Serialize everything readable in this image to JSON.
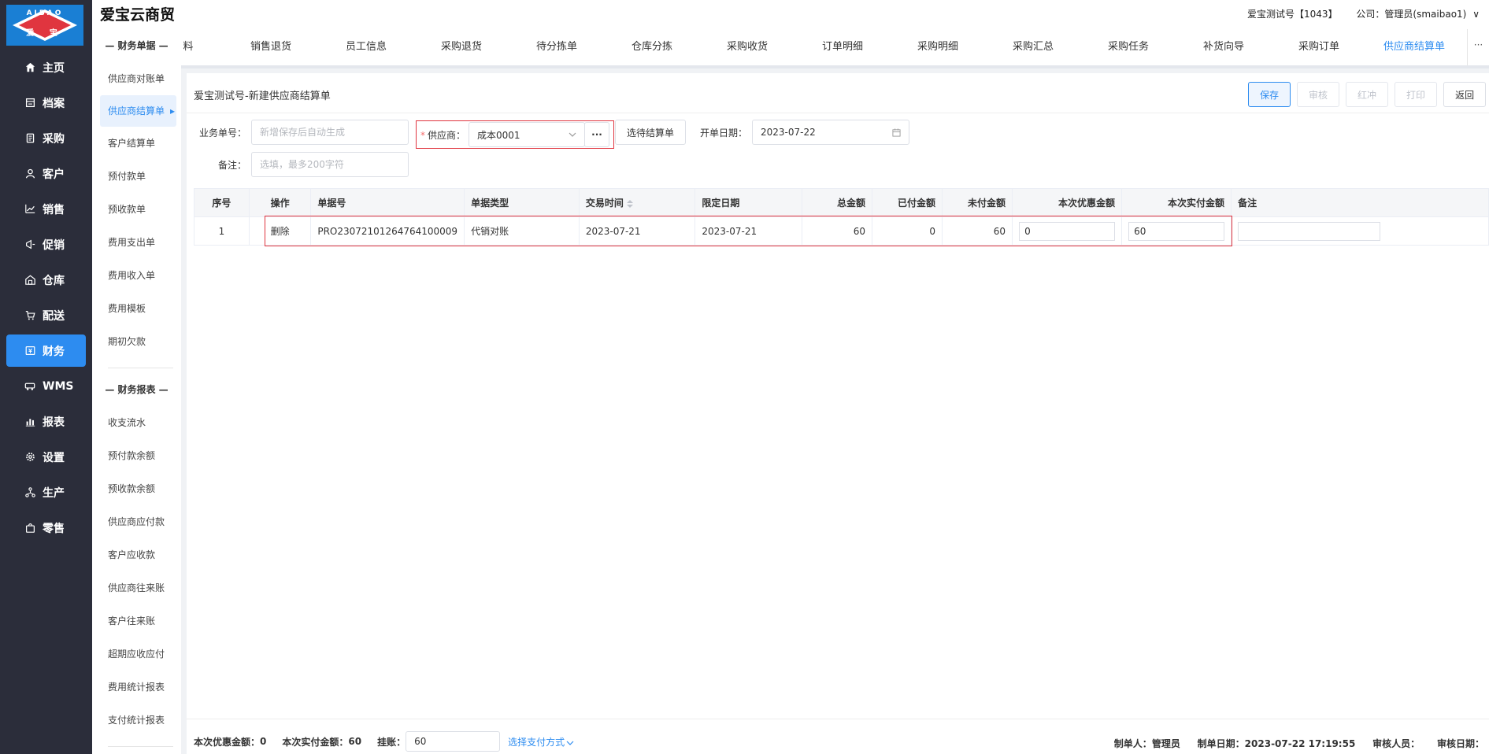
{
  "app": {
    "brand": "爱宝云商贸",
    "logo_top": "AIBAO",
    "logo_bottom": "爱 宝",
    "account": "爱宝测试号【1043】",
    "company_label": "公司：",
    "company_value": "管理员(smaibao1)",
    "company_caret": "∨"
  },
  "nav": [
    {
      "label": "主页",
      "icon": "home-icon"
    },
    {
      "label": "档案",
      "icon": "archive-icon"
    },
    {
      "label": "采购",
      "icon": "purchase-icon"
    },
    {
      "label": "客户",
      "icon": "user-icon"
    },
    {
      "label": "销售",
      "icon": "chart-icon"
    },
    {
      "label": "促销",
      "icon": "megaphone-icon"
    },
    {
      "label": "仓库",
      "icon": "warehouse-icon"
    },
    {
      "label": "配送",
      "icon": "cart-icon"
    },
    {
      "label": "财务",
      "icon": "finance-icon"
    },
    {
      "label": "WMS",
      "icon": "truck-icon"
    },
    {
      "label": "报表",
      "icon": "bar-chart-icon"
    },
    {
      "label": "设置",
      "icon": "gear-icon"
    },
    {
      "label": "生产",
      "icon": "network-icon"
    },
    {
      "label": "零售",
      "icon": "bag-icon"
    }
  ],
  "sub": {
    "group1": "— 财务单据 —",
    "items1": [
      "供应商对账单",
      "供应商结算单",
      "客户结算单",
      "预付款单",
      "预收款单",
      "费用支出单",
      "费用收入单",
      "费用模板",
      "期初欠款"
    ],
    "group2": "— 财务报表 —",
    "items2": [
      "收支流水",
      "预付款余额",
      "预收款余额",
      "供应商应付款",
      "客户应收款",
      "供应商往来账",
      "客户往来账",
      "超期应收应付",
      "费用统计报表",
      "支付统计报表"
    ]
  },
  "tabs": [
    "料",
    "销售退货",
    "员工信息",
    "采购退货",
    "待分拣单",
    "仓库分拣",
    "采购收货",
    "订单明细",
    "采购明细",
    "采购汇总",
    "采购任务",
    "补货向导",
    "采购订单",
    "供应商结算单"
  ],
  "tabs_more": "···",
  "page": {
    "title": "爱宝测试号-新建供应商结算单",
    "buttons": {
      "save": "保存",
      "audit": "审核",
      "red": "红冲",
      "print": "打印",
      "back": "返回"
    }
  },
  "form": {
    "bizno_label": "业务单号：",
    "bizno_placeholder": "新增保存后自动生成",
    "supplier_required": "*",
    "supplier_label": "供应商：",
    "supplier_value": "成本0001",
    "supplier_more": "···",
    "select_btn": "选待结算单",
    "date_label": "开单日期：",
    "date_value": "2023-07-22",
    "remark_label": "备注：",
    "remark_placeholder": "选填，最多200字符"
  },
  "table": {
    "headers": [
      "序号",
      "操作",
      "单据号",
      "单据类型",
      "交易时间",
      "限定日期",
      "总金额",
      "已付金额",
      "未付金额",
      "本次优惠金额",
      "本次实付金额",
      "备注"
    ],
    "rows": [
      {
        "no": "1",
        "op": "删除",
        "doc": "PRO23072101264764100009",
        "type": "代销对账",
        "trade_time": "2023-07-21",
        "limit_date": "2023-07-21",
        "total": "60",
        "paid": "0",
        "unpaid": "60",
        "discount": "0",
        "actual": "60",
        "remark": ""
      }
    ]
  },
  "footer": {
    "discount_label": "本次优惠金额：",
    "discount_value": "0",
    "actual_label": "本次实付金额：",
    "actual_value": "60",
    "hang_label": "挂账：",
    "hang_value": "60",
    "pay_method": "选择支付方式",
    "maker_label": "制单人：",
    "maker_value": "管理员",
    "make_date_label": "制单日期：",
    "make_date_value": "2023-07-22 17:19:55",
    "auditor_label": "审核人员：",
    "audit_date_label": "审核日期："
  },
  "colors": {
    "nav_bg": "#2b2d3a",
    "accent": "#2d8cf0",
    "highlight": "#e0353f"
  }
}
